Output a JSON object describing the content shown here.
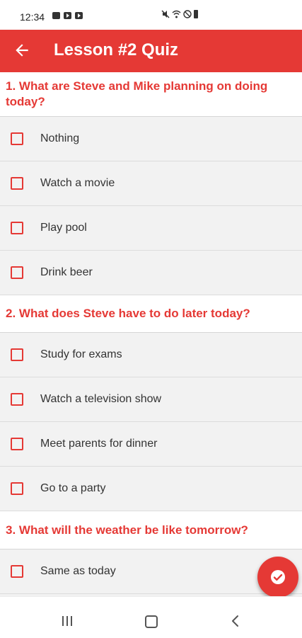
{
  "status_bar": {
    "time": "12:34",
    "left_icons": [
      "gallery-icon",
      "youtube-icon",
      "youtube-icon"
    ],
    "right_icons": [
      "mute-icon",
      "wifi-icon",
      "no-signal-icon",
      "battery-icon"
    ]
  },
  "app_bar": {
    "title": "Lesson #2 Quiz",
    "back_icon": "arrow-back-icon",
    "background_color": "#e53935"
  },
  "questions": [
    {
      "text": "1. What are Steve and Mike planning on doing today?",
      "options": [
        "Nothing",
        "Watch a movie",
        "Play pool",
        "Drink beer"
      ]
    },
    {
      "text": "2. What does Steve have to do later today?",
      "options": [
        "Study for exams",
        "Watch a television show",
        "Meet parents for dinner",
        "Go to a party"
      ]
    },
    {
      "text": "3. What will the weather be like tomorrow?",
      "options": [
        "Same as today"
      ]
    }
  ],
  "fab": {
    "icon": "check-circle-icon"
  },
  "nav_bar": {
    "icons": [
      "recents-icon",
      "home-icon",
      "back-icon"
    ]
  },
  "colors": {
    "accent": "#e53935",
    "option_bg": "#f2f2f2"
  }
}
